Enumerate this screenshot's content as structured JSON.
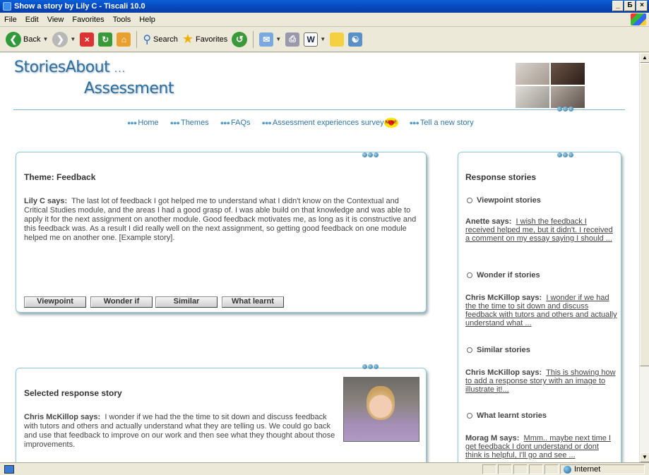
{
  "window": {
    "title": "Show a story by Lily C - Tiscali 10.0",
    "controls": [
      "_",
      "Б",
      "×"
    ]
  },
  "menu": [
    "File",
    "Edit",
    "View",
    "Favorites",
    "Tools",
    "Help"
  ],
  "toolbar": {
    "back_label": "Back",
    "search_label": "Search",
    "favorites_label": "Favorites"
  },
  "site": {
    "logo_line1": "StoriesAbout",
    "logo_dots": "...",
    "logo_line2": "Assessment"
  },
  "nav": {
    "items": [
      "Home",
      "Themes",
      "FAQs",
      "Assessment experiences survey",
      "Tell a new story"
    ],
    "badge": "NEW!"
  },
  "main": {
    "title": "Theme: Feedback",
    "author": "Lily C says:",
    "story": "The last lot of feedback I got helped me to understand what I didn't know on the Contextual and Critical Studies module, and the areas I had a good grasp of. I was able build on that knowledge and was able to apply it for the next assignment on another module. Good feedback motivates me, as long as it is constructive and this feedback was. As a result I did really well on the next assignment, so getting good feedback on one module helped me on another one. [Example story].",
    "buttons": [
      "Viewpoint",
      "Wonder if",
      "Similar",
      "What learnt"
    ]
  },
  "selected": {
    "title": "Selected response story",
    "author": "Chris McKillop says:",
    "story": "I wonder if we had the the time to sit down and discuss feedback with tutors and others and actually understand what they are telling us. We could go back and use that feedback to improve on our work and then see what they thought about those improvements."
  },
  "sidebar": {
    "title": "Response stories",
    "sections": [
      {
        "heading": "Viewpoint stories",
        "author": "Anette says:",
        "link": "I wish the feedback I received helped me, but it didn't. I received a comment on my essay saying I should ..."
      },
      {
        "heading": "Wonder if stories",
        "author": "Chris McKillop says:",
        "link": "I wonder if we had the the time to sit down and discuss feedback with tutors and others and actually understand what ..."
      },
      {
        "heading": "Similar stories",
        "author": "Chris McKillop says:",
        "link": "This is showing how to add a response story with an image to illustrate it!..."
      },
      {
        "heading": "What learnt stories",
        "author": "Morag M says:",
        "link": "Mmm.. maybe next time I get feedback I dont understand or dont think is helpful, I'll go and see ..."
      }
    ]
  },
  "status": {
    "zone": "Internet"
  }
}
